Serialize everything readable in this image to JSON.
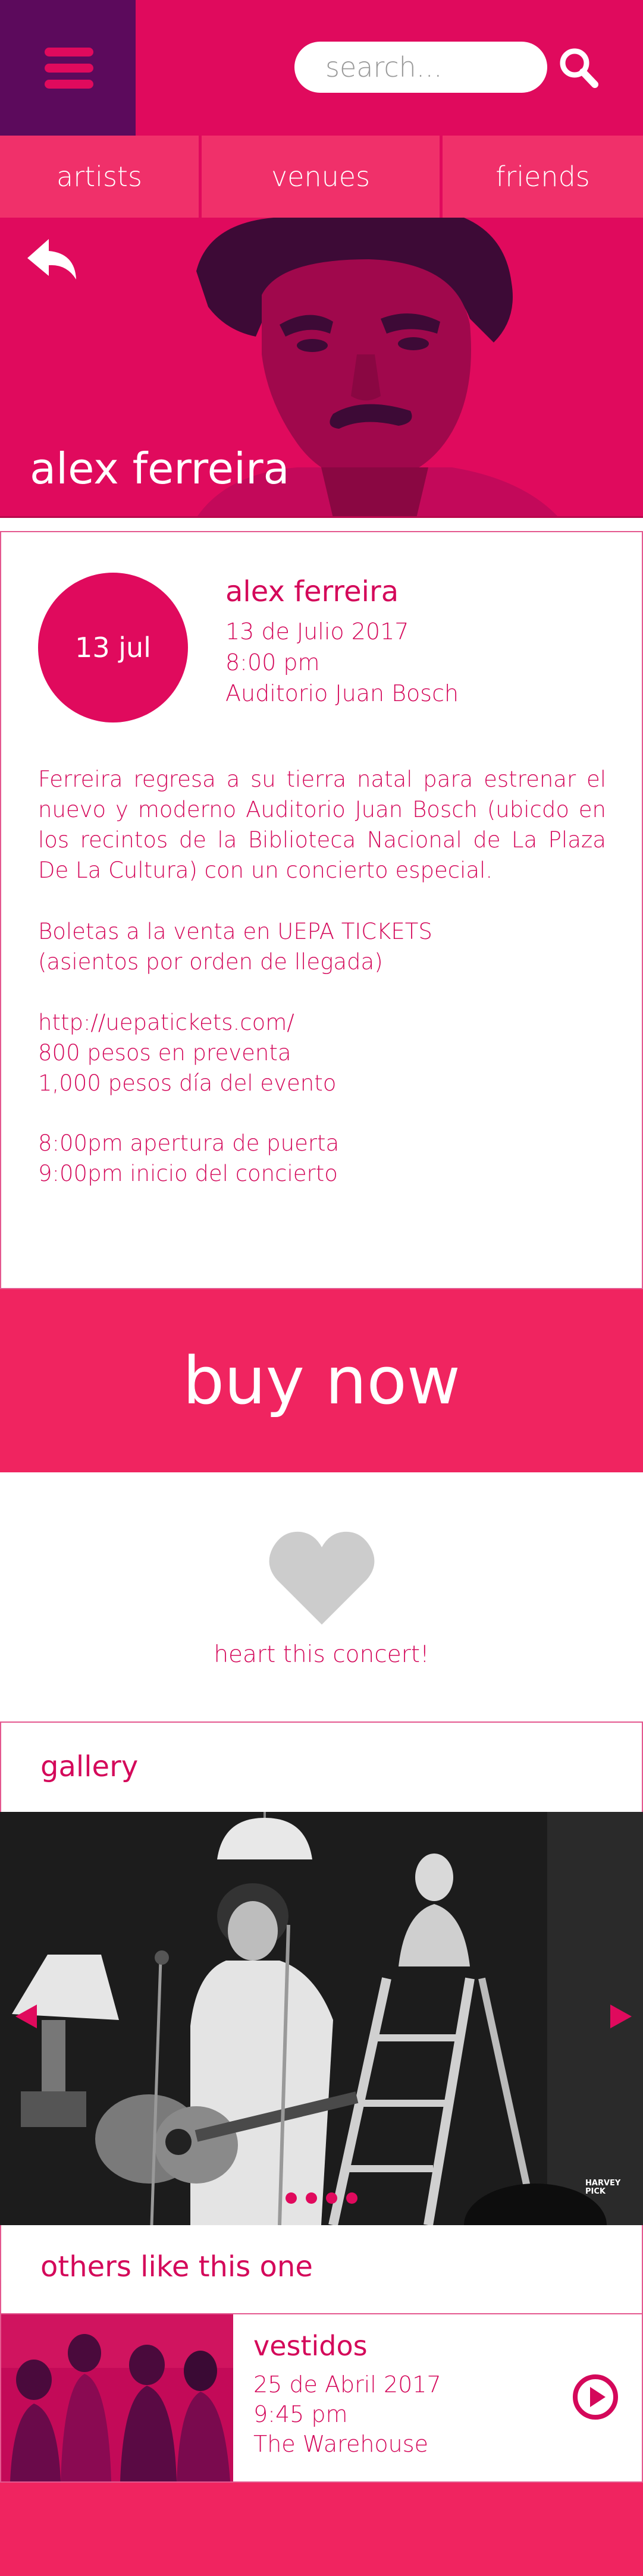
{
  "colors": {
    "brand": "#e00a5d",
    "menu_bg": "#5c0a5c",
    "tab_bg": "#f0306a",
    "buy_bg": "#f02460",
    "heart": "#cccccc"
  },
  "header": {
    "search_placeholder": "search...",
    "menu_icon": "hamburger-icon",
    "search_icon": "search-icon"
  },
  "tabs": [
    {
      "label": "artists"
    },
    {
      "label": "venues"
    },
    {
      "label": "friends"
    }
  ],
  "hero": {
    "artist": "alex ferreira",
    "back_icon": "back-arrow-icon"
  },
  "event": {
    "date": "13 jul",
    "title": "alex ferreira",
    "date_full": "13 de Julio 2017",
    "time": "8:00 pm",
    "venue": "Auditorio Juan Bosch",
    "description": "Ferreira regresa a su tierra natal para estrenar el nuevo y moderno Auditorio Juan Bosch (ubicdo en los recintos de la Biblioteca Nacional de La Plaza De La Cultura) con un concierto especial.",
    "tickets_line1": "Boletas a la venta en UEPA TICKETS",
    "tickets_line2": "(asientos por orden de llegada)",
    "link": "http://uepatickets.com/",
    "price_presale": "800 pesos en preventa",
    "price_door": "1,000 pesos día del evento",
    "doors": "8:00pm apertura de puerta",
    "start": "9:00pm inicio del concierto"
  },
  "buy": {
    "label": "buy now"
  },
  "heart": {
    "label": "heart this concert!",
    "icon": "heart-icon"
  },
  "gallery": {
    "title": "gallery",
    "dots": 4,
    "credit": "HARVEY PICK"
  },
  "others": {
    "title": "others like this one",
    "items": [
      {
        "title": "vestidos",
        "date": "25 de Abril 2017",
        "time": "9:45 pm",
        "venue": "The Warehouse",
        "icon": "play-icon"
      }
    ]
  }
}
